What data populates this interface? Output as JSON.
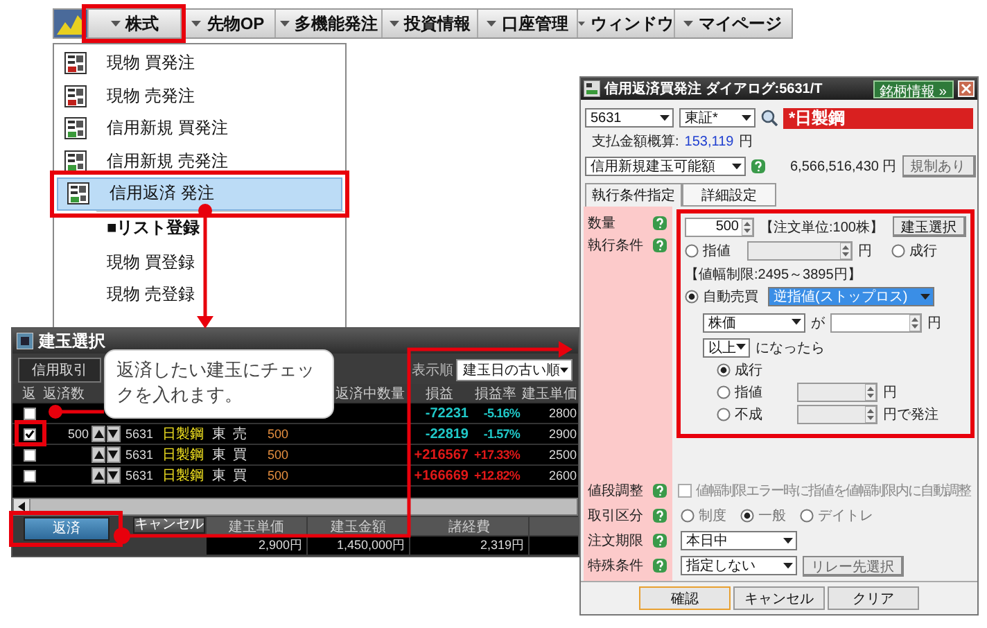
{
  "menu_bar": {
    "items": [
      {
        "label": "株式",
        "selected": true
      },
      {
        "label": "先物OP",
        "selected": false
      },
      {
        "label": "多機能発注",
        "selected": false
      },
      {
        "label": "投資情報",
        "selected": false
      },
      {
        "label": "口座管理",
        "selected": false
      },
      {
        "label": "ウィンドウ",
        "selected": false
      },
      {
        "label": "マイページ",
        "selected": false
      }
    ]
  },
  "dropdown_menu": {
    "items": [
      {
        "kind": "order",
        "label": "現物 買発注",
        "selected": false
      },
      {
        "kind": "order",
        "label": "現物 売発注",
        "selected": false
      },
      {
        "kind": "order",
        "label": "信用新規 買発注",
        "selected": false
      },
      {
        "kind": "order",
        "label": "信用新規 売発注",
        "selected": false
      },
      {
        "kind": "order",
        "label": "信用返済 発注",
        "selected": true
      },
      {
        "kind": "header",
        "label": "■リスト登録",
        "selected": false
      },
      {
        "kind": "plain",
        "label": "現物 買登録",
        "selected": false
      },
      {
        "kind": "plain",
        "label": "現物 売登録",
        "selected": false
      }
    ]
  },
  "position_dialog": {
    "title": "建玉選択",
    "tabs": [
      {
        "label": "信用取引",
        "selected": true
      }
    ],
    "sort_label": "表示順",
    "sort_value": "建玉日の古い順",
    "columns": {
      "check": "返",
      "quantity": "返済数",
      "pending": "返済中数量",
      "profit": "損益",
      "rate": "損益率",
      "unit_price": "建玉単価"
    },
    "rows": [
      {
        "checked": false,
        "movable": false,
        "profit": "-72231",
        "rate": "-5.16%",
        "unit_price": "2800",
        "kind": "loss"
      },
      {
        "checked": true,
        "movable": true,
        "quantity": "500",
        "code": "5631",
        "name": "日製鋼",
        "market": "東",
        "side": "売",
        "amount": "500",
        "profit": "-22819",
        "rate": "-1.57%",
        "unit_price": "2900",
        "kind": "loss"
      },
      {
        "checked": false,
        "movable": true,
        "code": "5631",
        "name": "日製鋼",
        "market": "東",
        "side": "買",
        "amount": "500",
        "profit": "+216567",
        "rate": "+17.33%",
        "unit_price": "2500",
        "kind": "gain"
      },
      {
        "checked": false,
        "movable": true,
        "code": "5631",
        "name": "日製鋼",
        "market": "東",
        "side": "買",
        "amount": "500",
        "profit": "+166669",
        "rate": "+12.82%",
        "unit_price": "2600",
        "kind": "gain"
      }
    ],
    "buttons": [
      "返済",
      "キャンセル"
    ],
    "summary": [
      {
        "label": "建玉単価",
        "value": "2,900円"
      },
      {
        "label": "建玉金額",
        "value": "1,450,000円"
      },
      {
        "label": "諸経費",
        "value": "2,319円"
      }
    ]
  },
  "callout": {
    "text": "返済したい建玉にチェックを入れます。"
  },
  "order_dialog": {
    "title": "信用返済買発注 ダイアログ:5631/T",
    "info_button": "銘柄情報 »",
    "code": "5631",
    "market": "東証*",
    "stock_name": "*日製鋼",
    "payment_label": "支払金額概算:",
    "payment_value": "153,119",
    "payment_unit": "円",
    "limit_select": "信用新規建玉可能額",
    "limit_value": "6,566,516,430 円",
    "regulation_button": "規制あり",
    "tabs": [
      {
        "label": "執行条件指定",
        "selected": true
      },
      {
        "label": "詳細設定",
        "selected": false
      }
    ],
    "quantity": {
      "label": "数量",
      "value": "500",
      "note": "【注文単位:100株】",
      "button": "建玉選択"
    },
    "execution": {
      "label": "執行条件",
      "options": [
        {
          "label": "指値",
          "selected": false
        },
        {
          "label": "成行",
          "selected": false
        }
      ],
      "price_unit": "円",
      "range_note": "【値幅制限:2495～3895円】",
      "auto": {
        "label": "自動売買",
        "selected": true,
        "type": "逆指値(ストップロス)",
        "basis": "株価",
        "particle": "が",
        "unit": "円",
        "condition": "以上",
        "then": "になったら",
        "sub_options": [
          {
            "label": "成行",
            "selected": true
          },
          {
            "label": "指値",
            "selected": false,
            "unit": "円"
          },
          {
            "label": "不成",
            "selected": false,
            "unit": "円で発注"
          }
        ]
      }
    },
    "price_adjust": {
      "label": "値段調整",
      "text": "値幅制限エラー時に指値を値幅制限内に自動調整",
      "checked": false,
      "disabled": true
    },
    "trade_type": {
      "label": "取引区分",
      "disabled": true,
      "options": [
        {
          "label": "制度",
          "selected": false
        },
        {
          "label": "一般",
          "selected": true
        },
        {
          "label": "デイトレ",
          "selected": false
        }
      ]
    },
    "expiry": {
      "label": "注文期限",
      "value": "本日中"
    },
    "special": {
      "label": "特殊条件",
      "value": "指定しない",
      "button": "リレー先選択"
    },
    "footer_buttons": [
      {
        "label": "確認",
        "default": true
      },
      {
        "label": "キャンセル",
        "default": false
      },
      {
        "label": "クリア",
        "default": false
      }
    ]
  }
}
